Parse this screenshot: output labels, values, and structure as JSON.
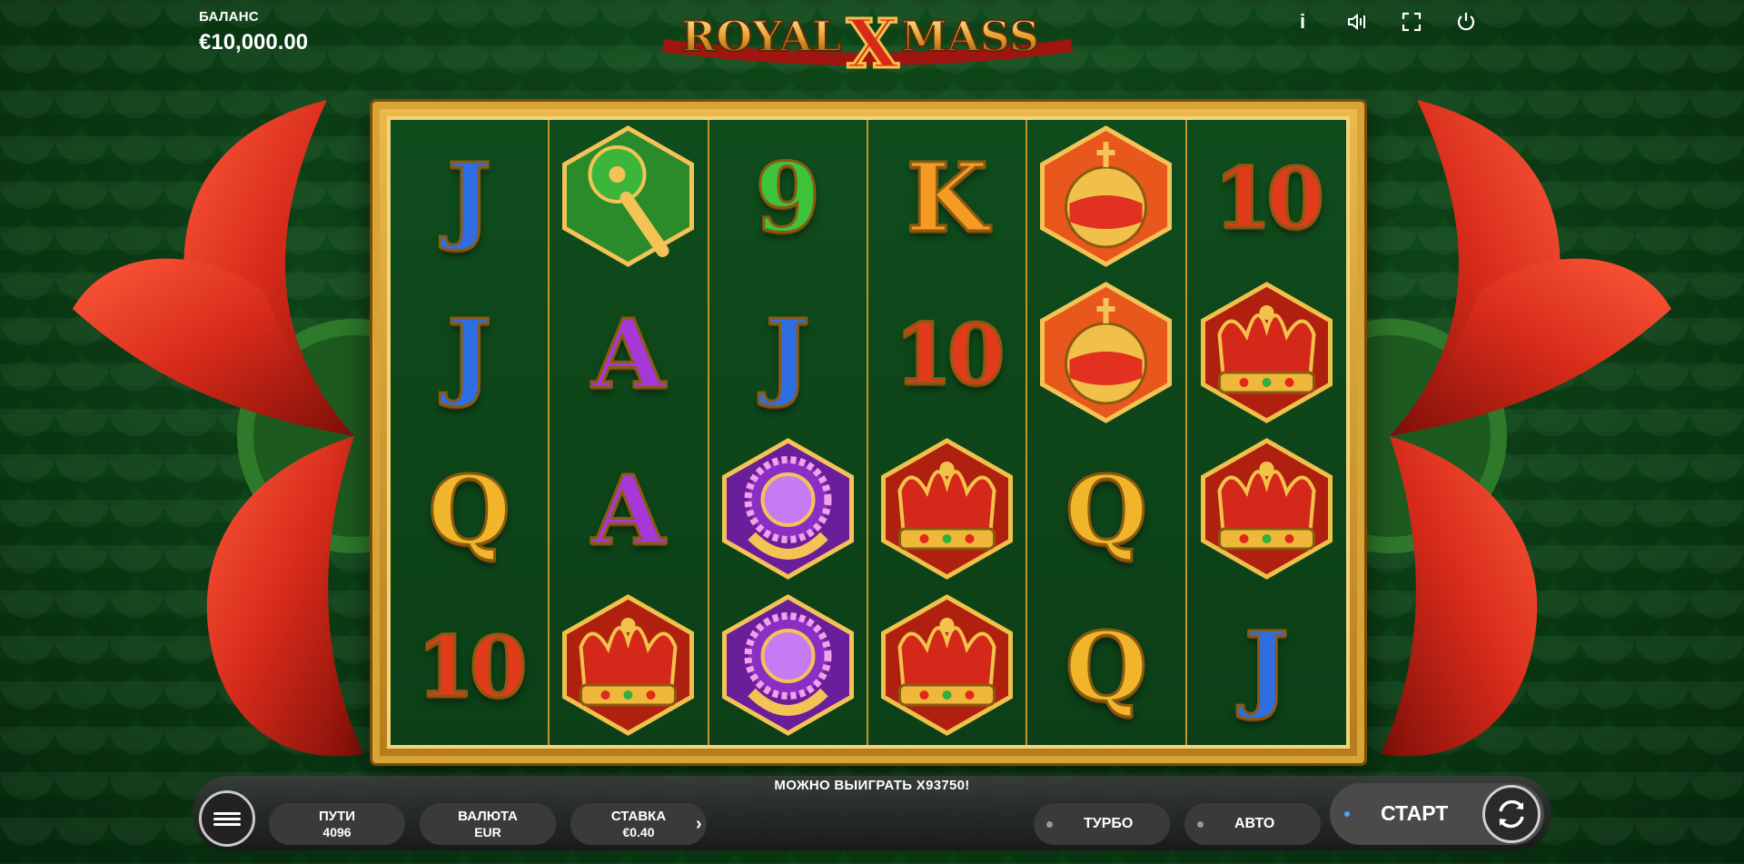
{
  "balance": {
    "label": "БАЛАНС",
    "value": "€10,000.00"
  },
  "logo": {
    "text_left": "ROYAL",
    "text_x": "X",
    "text_right": "MASS"
  },
  "top_icons": [
    {
      "name": "info-icon",
      "glyph": "i"
    },
    {
      "name": "sound-icon"
    },
    {
      "name": "fullscreen-icon"
    },
    {
      "name": "power-icon"
    }
  ],
  "reels": [
    [
      {
        "type": "text",
        "text": "J",
        "color": "blue"
      },
      {
        "type": "scepter"
      },
      {
        "type": "text",
        "text": "9",
        "color": "green"
      },
      {
        "type": "text",
        "text": "K",
        "color": "orange"
      },
      {
        "type": "orb"
      },
      {
        "type": "text",
        "text": "10",
        "color": "red"
      }
    ],
    [
      {
        "type": "text",
        "text": "J",
        "color": "blue"
      },
      {
        "type": "text",
        "text": "A",
        "color": "purple"
      },
      {
        "type": "text",
        "text": "J",
        "color": "blue"
      },
      {
        "type": "text",
        "text": "10",
        "color": "red"
      },
      {
        "type": "orb"
      },
      {
        "type": "crown"
      }
    ],
    [
      {
        "type": "text",
        "text": "Q",
        "color": "gold"
      },
      {
        "type": "text",
        "text": "A",
        "color": "purple"
      },
      {
        "type": "ring"
      },
      {
        "type": "crown"
      },
      {
        "type": "text",
        "text": "Q",
        "color": "gold"
      },
      {
        "type": "crown"
      }
    ],
    [
      {
        "type": "text",
        "text": "10",
        "color": "red"
      },
      {
        "type": "crown"
      },
      {
        "type": "ring"
      },
      {
        "type": "crown"
      },
      {
        "type": "text",
        "text": "Q",
        "color": "gold"
      },
      {
        "type": "text",
        "text": "J",
        "color": "blue"
      }
    ]
  ],
  "win_text": "МОЖНО ВЫИГРАТЬ X93750!",
  "controls": {
    "ways_label": "ПУТИ",
    "ways_value": "4096",
    "currency_label": "ВАЛЮТА",
    "currency_value": "EUR",
    "bet_label": "СТАВКА",
    "bet_value": "€0.40",
    "arrow": "›",
    "turbo": "ТУРБО",
    "auto": "АВТО",
    "start": "СТАРТ"
  },
  "colors": {
    "frame_gold": "#d9a436",
    "felt_green": "#0f4c1c",
    "ribbon_red": "#d52a1a"
  }
}
